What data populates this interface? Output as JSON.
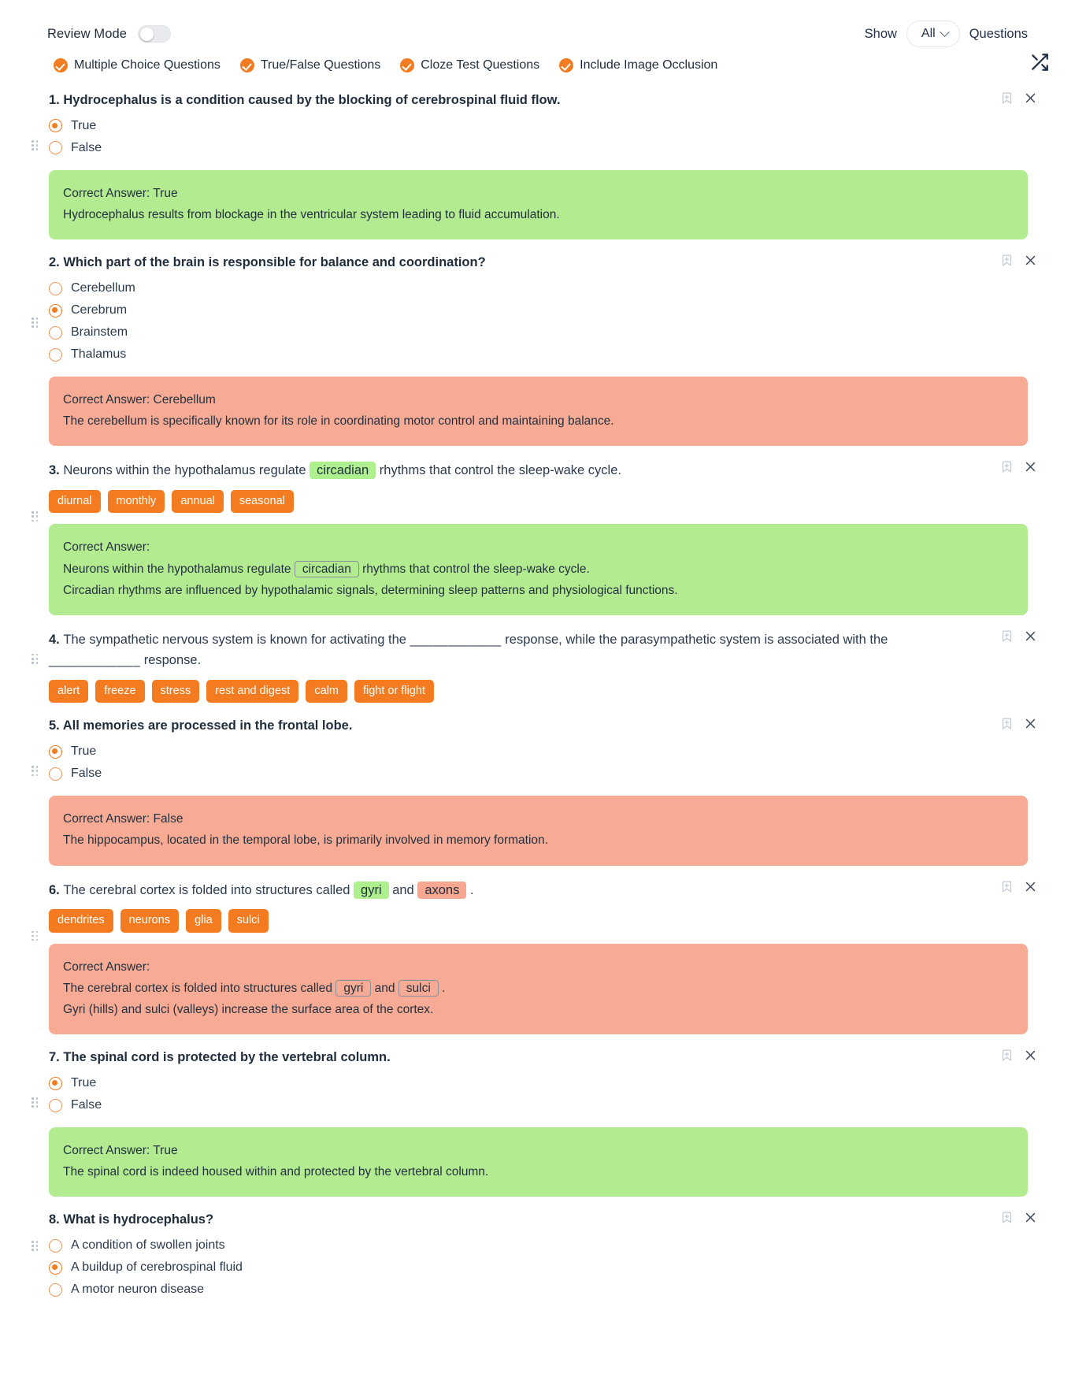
{
  "topbar": {
    "review_mode_label": "Review Mode",
    "review_mode_on": false,
    "show_label": "Show",
    "show_value": "All",
    "questions_label": "Questions",
    "shuffle_icon": "shuffle-icon"
  },
  "filters": [
    {
      "label": "Multiple Choice Questions",
      "checked": true
    },
    {
      "label": "True/False Questions",
      "checked": true
    },
    {
      "label": "Cloze Test Questions",
      "checked": true
    },
    {
      "label": "Include Image Occlusion",
      "checked": true
    }
  ],
  "colors": {
    "accent": "#f47b20",
    "correct_bg": "#b3eb90",
    "incorrect_bg": "#f7ab95",
    "cloze_correct": "#aef08d",
    "cloze_incorrect": "#f8a791",
    "text": "#1f2d3d"
  },
  "questions": [
    {
      "number": "1.",
      "type": "true-false",
      "text": "Hydrocephalus is a condition caused by the blocking of cerebrospinal fluid flow.",
      "bold": true,
      "options": [
        {
          "label": "True",
          "selected": true
        },
        {
          "label": "False",
          "selected": false
        }
      ],
      "answer": {
        "status": "ok",
        "heading": "Correct Answer: True",
        "explanation": "Hydrocephalus results from blockage in the ventricular system leading to fluid accumulation."
      }
    },
    {
      "number": "2.",
      "type": "multiple-choice",
      "text": "Which part of the brain is responsible for balance and coordination?",
      "bold": true,
      "options": [
        {
          "label": "Cerebellum",
          "selected": false
        },
        {
          "label": "Cerebrum",
          "selected": true
        },
        {
          "label": "Brainstem",
          "selected": false
        },
        {
          "label": "Thalamus",
          "selected": false
        }
      ],
      "answer": {
        "status": "bad",
        "heading": "Correct Answer: Cerebellum",
        "explanation": "The cerebellum is specifically known for its role in coordinating motor control and maintaining balance."
      }
    },
    {
      "number": "3.",
      "type": "cloze",
      "bold": false,
      "segments": [
        {
          "kind": "text",
          "value": "Neurons within the hypothalamus regulate "
        },
        {
          "kind": "blank-correct",
          "value": "circadian"
        },
        {
          "kind": "text",
          "value": " rhythms that control the sleep-wake cycle."
        }
      ],
      "wordbank": [
        "diurnal",
        "monthly",
        "annual",
        "seasonal"
      ],
      "answer": {
        "status": "ok",
        "heading": "Correct Answer:",
        "segments": [
          {
            "kind": "text",
            "value": "Neurons within the hypothalamus regulate "
          },
          {
            "kind": "boxed",
            "value": "circadian"
          },
          {
            "kind": "text",
            "value": " rhythms that control the sleep-wake cycle."
          }
        ],
        "explanation": "Circadian rhythms are influenced by hypothalamic signals, determining sleep patterns and physiological functions."
      }
    },
    {
      "number": "4.",
      "type": "cloze",
      "bold": false,
      "segments": [
        {
          "kind": "text",
          "value": "The sympathetic nervous system is known for activating the "
        },
        {
          "kind": "blank-empty",
          "value": "____________"
        },
        {
          "kind": "text",
          "value": " response, while the parasympathetic system is associated with the "
        },
        {
          "kind": "blank-empty",
          "value": "____________"
        },
        {
          "kind": "text",
          "value": " response."
        }
      ],
      "wordbank": [
        "alert",
        "freeze",
        "stress",
        "rest and digest",
        "calm",
        "fight or flight"
      ],
      "answer": null
    },
    {
      "number": "5.",
      "type": "true-false",
      "text": "All memories are processed in the frontal lobe.",
      "bold": true,
      "options": [
        {
          "label": "True",
          "selected": true
        },
        {
          "label": "False",
          "selected": false
        }
      ],
      "answer": {
        "status": "bad",
        "heading": "Correct Answer: False",
        "explanation": "The hippocampus, located in the temporal lobe, is primarily involved in memory formation."
      }
    },
    {
      "number": "6.",
      "type": "cloze",
      "bold": false,
      "segments": [
        {
          "kind": "text",
          "value": "The cerebral cortex is folded into structures called "
        },
        {
          "kind": "blank-correct",
          "value": "gyri"
        },
        {
          "kind": "text",
          "value": " and "
        },
        {
          "kind": "blank-incorrect",
          "value": "axons"
        },
        {
          "kind": "text",
          "value": " ."
        }
      ],
      "wordbank": [
        "dendrites",
        "neurons",
        "glia",
        "sulci"
      ],
      "answer": {
        "status": "bad",
        "heading": "Correct Answer:",
        "segments": [
          {
            "kind": "text",
            "value": "The cerebral cortex is folded into structures called "
          },
          {
            "kind": "boxed",
            "value": "gyri"
          },
          {
            "kind": "text",
            "value": " and "
          },
          {
            "kind": "boxed",
            "value": "sulci"
          },
          {
            "kind": "text",
            "value": " ."
          }
        ],
        "explanation": "Gyri (hills) and sulci (valleys) increase the surface area of the cortex."
      }
    },
    {
      "number": "7.",
      "type": "true-false",
      "text": "The spinal cord is protected by the vertebral column.",
      "bold": true,
      "options": [
        {
          "label": "True",
          "selected": true
        },
        {
          "label": "False",
          "selected": false
        }
      ],
      "answer": {
        "status": "ok",
        "heading": "Correct Answer: True",
        "explanation": "The spinal cord is indeed housed within and protected by the vertebral column."
      }
    },
    {
      "number": "8.",
      "type": "multiple-choice",
      "text": "What is hydrocephalus?",
      "bold": true,
      "options": [
        {
          "label": "A condition of swollen joints",
          "selected": false
        },
        {
          "label": "A buildup of cerebrospinal fluid",
          "selected": true
        },
        {
          "label": "A motor neuron disease",
          "selected": false
        }
      ],
      "answer": null
    }
  ],
  "icons": {
    "bookmark": "bookmark-plus-icon",
    "close": "close-icon",
    "drag": "drag-handle-icon"
  }
}
